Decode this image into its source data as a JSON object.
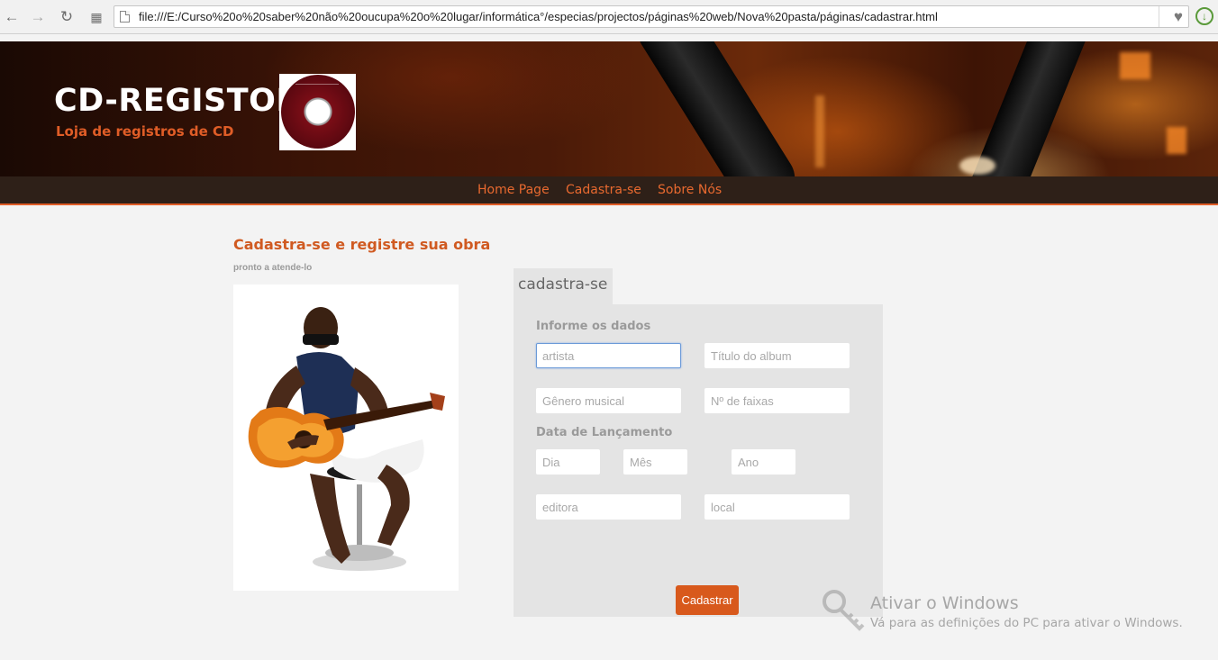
{
  "browser": {
    "url": "file:///E:/Curso%20o%20saber%20não%20oucupa%20o%20lugar/informática°/especias/projectos/páginas%20web/Nova%20pasta/páginas/cadastrar.html",
    "icons": [
      "back-arrow-icon",
      "forward-arrow-icon",
      "reload-icon",
      "apps-grid-icon",
      "page-icon",
      "heart-icon",
      "update-icon"
    ]
  },
  "header": {
    "title": "CD-REGISTOR",
    "subtitle": "Loja de registros de CD",
    "logo_icon": "cd-disc-icon"
  },
  "nav": {
    "items": [
      {
        "label": "Home Page"
      },
      {
        "label": "Cadastra-se"
      },
      {
        "label": "Sobre Nós"
      }
    ]
  },
  "content": {
    "heading": "Cadastra-se e registre sua obra",
    "subheading": "pronto a atende-lo"
  },
  "form": {
    "tab_label": "cadastra-se",
    "section1": "Informe os dados",
    "section2": "Data de Lançamento",
    "fields": {
      "artista": {
        "placeholder": "artista",
        "value": ""
      },
      "album": {
        "placeholder": "Título do album",
        "value": ""
      },
      "genero": {
        "placeholder": "Gênero musical",
        "value": ""
      },
      "faixas": {
        "placeholder": "Nº de faixas",
        "value": ""
      },
      "dia": {
        "placeholder": "Dia",
        "value": ""
      },
      "mes": {
        "placeholder": "Mês",
        "value": ""
      },
      "ano": {
        "placeholder": "Ano",
        "value": ""
      },
      "editora": {
        "placeholder": "editora",
        "value": ""
      },
      "local": {
        "placeholder": "local",
        "value": ""
      }
    },
    "submit_label": "Cadastrar"
  },
  "watermark": {
    "title": "Ativar o Windows",
    "subtitle": "Vá para as definições do PC para ativar o Windows."
  },
  "colors": {
    "accent": "#d8591c",
    "nav_bg": "#2e2018",
    "panel_bg": "#e4e4e4"
  }
}
